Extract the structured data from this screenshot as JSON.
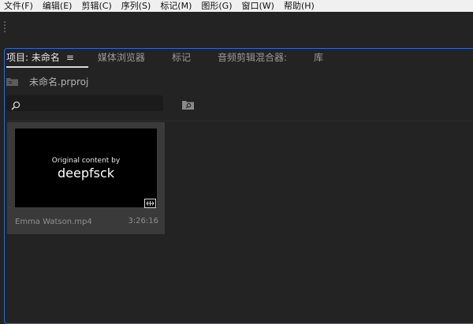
{
  "menu": [
    "文件(F)",
    "编辑(E)",
    "剪辑(C)",
    "序列(S)",
    "标记(M)",
    "图形(G)",
    "窗口(W)",
    "帮助(H)"
  ],
  "tabs": [
    {
      "label": "项目: 未命名",
      "active": true
    },
    {
      "label": "媒体浏览器",
      "active": false
    },
    {
      "label": "标记",
      "active": false
    },
    {
      "label": "音频剪辑混合器:",
      "active": false
    },
    {
      "label": "库",
      "active": false
    }
  ],
  "project": {
    "name": "未命名.prproj"
  },
  "search": {
    "value": "",
    "placeholder": ""
  },
  "clip": {
    "thumb_line1": "Original content by",
    "thumb_line2": "deepfsck",
    "name": "Emma Watson.mp4",
    "duration": "3:26:16"
  },
  "colors": {
    "accent": "#2d6bd6",
    "panel": "#232323",
    "card": "#3a3a3a"
  },
  "icons": [
    "hamburger-menu-icon",
    "bin-folder-icon",
    "search-icon",
    "new-bin-icon",
    "video-clip-badge-icon"
  ]
}
